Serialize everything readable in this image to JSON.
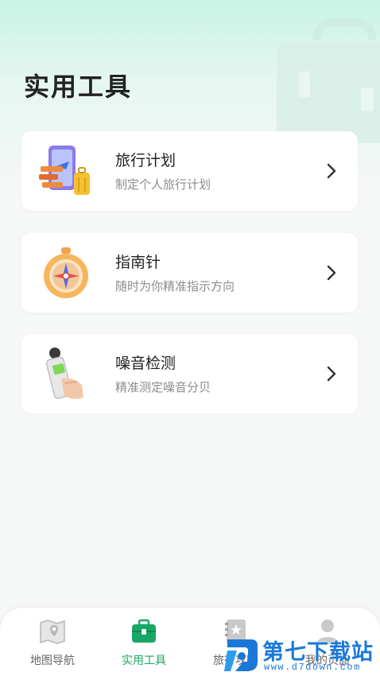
{
  "page": {
    "title": "实用工具"
  },
  "tools": [
    {
      "title": "旅行计划",
      "subtitle": "制定个人旅行计划",
      "icon": "travel-plan-icon"
    },
    {
      "title": "指南针",
      "subtitle": "随时为你精准指示方向",
      "icon": "compass-icon"
    },
    {
      "title": "噪音检测",
      "subtitle": "精准测定噪音分贝",
      "icon": "noise-meter-icon"
    }
  ],
  "tabs": [
    {
      "label": "地图导航",
      "icon": "map-icon",
      "active": false
    },
    {
      "label": "实用工具",
      "icon": "toolbox-icon",
      "active": true
    },
    {
      "label": "旅行攻略",
      "icon": "guide-book-icon",
      "active": false
    },
    {
      "label": "我的页面",
      "icon": "profile-icon",
      "active": false
    }
  ],
  "watermark": {
    "text": "第七下载站",
    "url": "www.d7down.com"
  },
  "colors": {
    "accent": "#1aa765",
    "background": "#f6f7f7",
    "watermark": "#1a78d8"
  }
}
